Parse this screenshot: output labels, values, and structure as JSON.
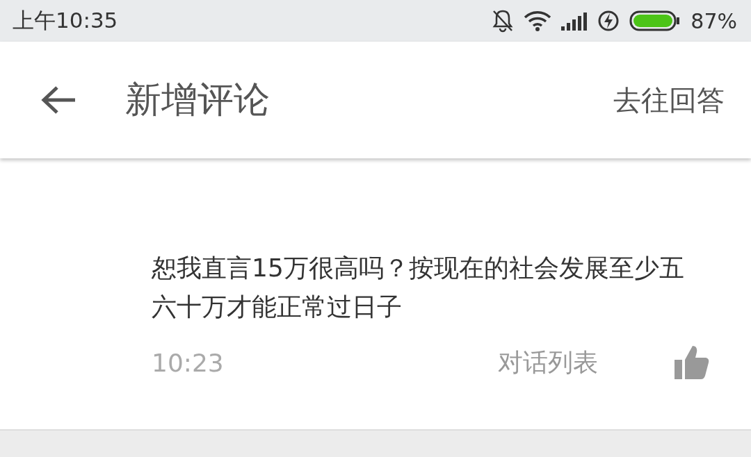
{
  "status_bar": {
    "time": "上午10:35",
    "battery": "87%"
  },
  "header": {
    "title": "新增评论",
    "action": "去往回答"
  },
  "comment": {
    "text": "恕我直言15万很高吗？按现在的社会发展至少五六十万才能正常过日子",
    "time": "10:23",
    "thread_link": "对话列表"
  }
}
